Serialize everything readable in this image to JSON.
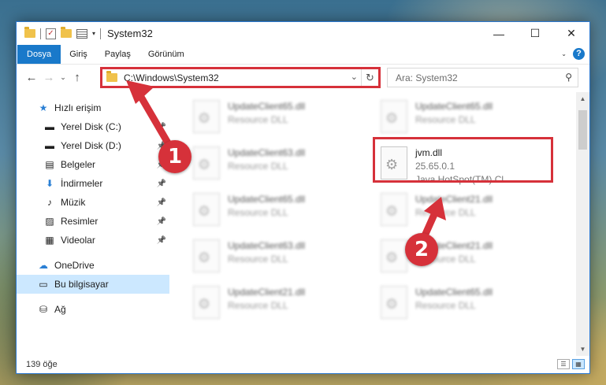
{
  "window": {
    "title": "System32",
    "controls": {
      "minimize": "—",
      "maximize": "☐",
      "close": "✕"
    }
  },
  "ribbon": {
    "tabs": [
      "Dosya",
      "Giriş",
      "Paylaş",
      "Görünüm"
    ],
    "help": "?"
  },
  "address": {
    "path": "C:\\Windows\\System32",
    "search_placeholder": "Ara: System32"
  },
  "nav": {
    "items": [
      {
        "label": "Hızlı erişim",
        "icon": "star-icon",
        "glyph": "★",
        "pinned": false,
        "level": 1
      },
      {
        "label": "Yerel Disk (C:)",
        "icon": "drive-icon",
        "glyph": "▬",
        "pinned": true,
        "level": 2
      },
      {
        "label": "Yerel Disk (D:)",
        "icon": "drive-icon",
        "glyph": "▬",
        "pinned": true,
        "level": 2
      },
      {
        "label": "Belgeler",
        "icon": "documents-icon",
        "glyph": "▤",
        "pinned": true,
        "level": 2
      },
      {
        "label": "İndirmeler",
        "icon": "downloads-icon",
        "glyph": "⬇",
        "pinned": true,
        "level": 2
      },
      {
        "label": "Müzik",
        "icon": "music-icon",
        "glyph": "♪",
        "pinned": true,
        "level": 2
      },
      {
        "label": "Resimler",
        "icon": "pictures-icon",
        "glyph": "▨",
        "pinned": true,
        "level": 2
      },
      {
        "label": "Videolar",
        "icon": "videos-icon",
        "glyph": "▦",
        "pinned": true,
        "level": 2
      },
      {
        "label": "OneDrive",
        "icon": "cloud-icon",
        "glyph": "☁",
        "pinned": false,
        "level": 1
      },
      {
        "label": "Bu bilgisayar",
        "icon": "computer-icon",
        "glyph": "▭",
        "pinned": false,
        "level": 1,
        "selected": true
      },
      {
        "label": "Ağ",
        "icon": "network-icon",
        "glyph": "⛁",
        "pinned": false,
        "level": 1
      }
    ]
  },
  "files": [
    {
      "name": "UpdateClient65.dll",
      "desc": "Resource DLL"
    },
    {
      "name": "UpdateClient65.dll",
      "desc": "Resource DLL"
    },
    {
      "name": "UpdateClient63.dll",
      "desc": "Resource DLL"
    },
    {
      "name": "jvm.dll",
      "version": "25.65.0.1",
      "desc": "Java HotSpot(TM) Cl..."
    },
    {
      "name": "UpdateClient65.dll",
      "desc": "Resource DLL"
    },
    {
      "name": "UpdateClient21.dll",
      "desc": "Resource DLL"
    },
    {
      "name": "UpdateClient63.dll",
      "desc": "Resource DLL"
    },
    {
      "name": "UpdateClient21.dll",
      "desc": "Resource DLL"
    },
    {
      "name": "UpdateClient21.dll",
      "desc": "Resource DLL"
    },
    {
      "name": "UpdateClient65.dll",
      "desc": "Resource DLL"
    }
  ],
  "status": {
    "count": "139 öğe"
  },
  "callouts": [
    "1",
    "2"
  ],
  "colors": {
    "accent": "#1979ca",
    "highlight": "#d6313a",
    "selection": "#cce8ff"
  }
}
